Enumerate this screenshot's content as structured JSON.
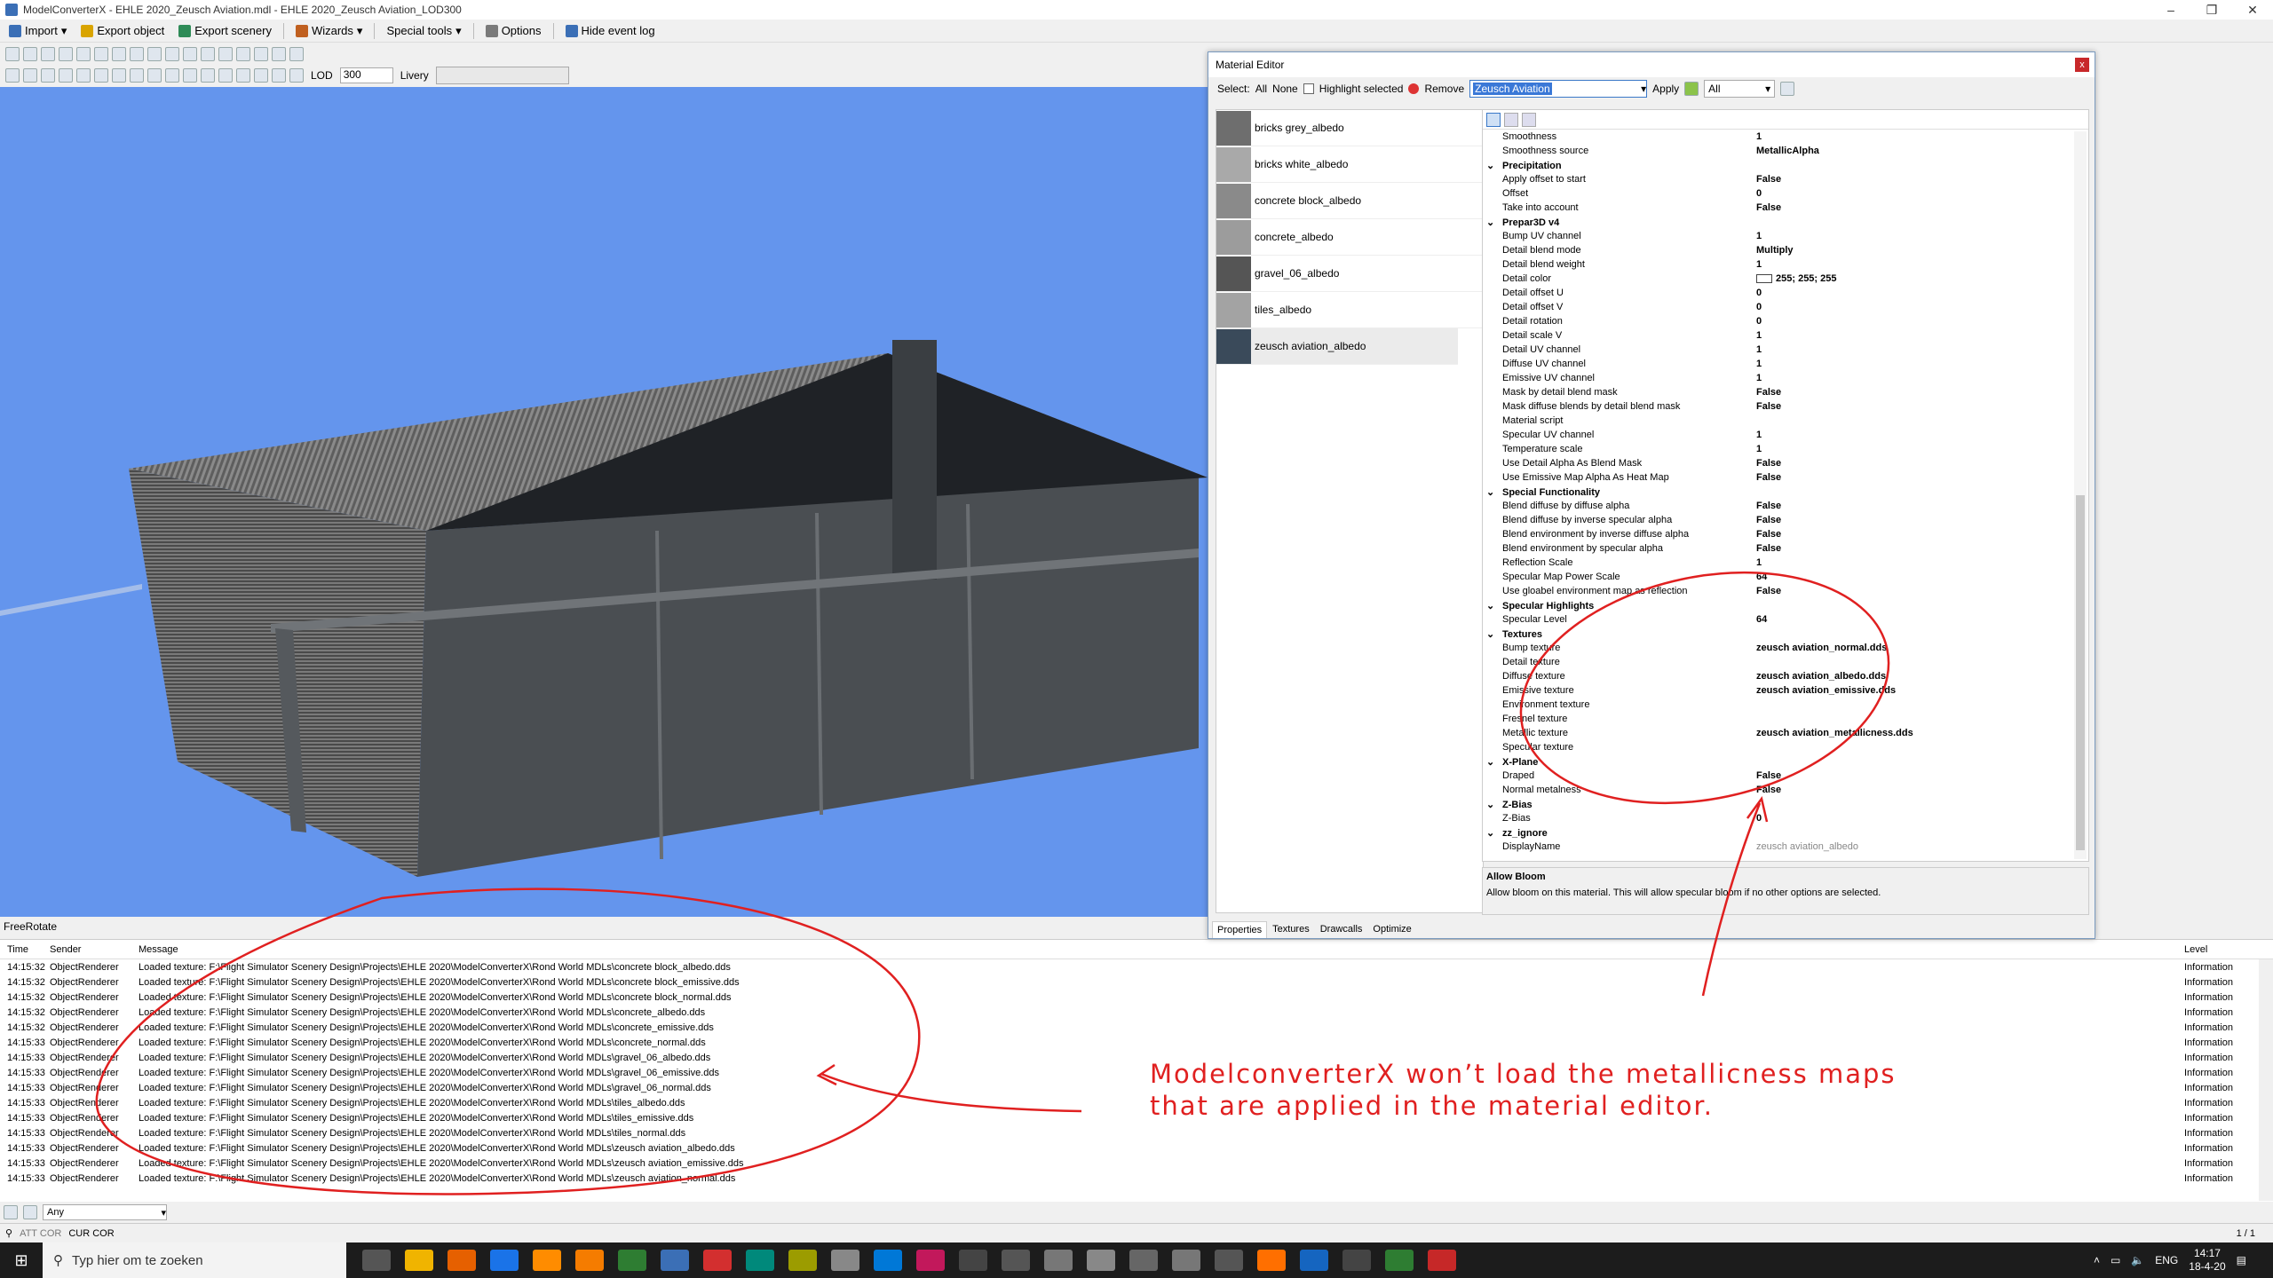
{
  "window": {
    "title": "ModelConverterX - EHLE 2020_Zeusch Aviation.mdl - EHLE 2020_Zeusch Aviation_LOD300",
    "controls": [
      "–",
      "❐",
      "✕"
    ]
  },
  "menubar": {
    "items": [
      {
        "label": "Import",
        "icon": "import-icon",
        "color": "#3b6fb6"
      },
      {
        "label": "Export object",
        "icon": "export-object-icon",
        "color": "#d9a400"
      },
      {
        "label": "Export scenery",
        "icon": "export-scenery-icon",
        "color": "#2e8b57"
      },
      {
        "label": "Wizards",
        "icon": "wizards-icon",
        "color": "#c06020"
      },
      {
        "label": "Special tools",
        "icon": "special-tools-icon",
        "color": "#777"
      },
      {
        "label": "Options",
        "icon": "options-icon",
        "color": "#7a7a7a"
      },
      {
        "label": "Hide event log",
        "icon": "event-log-icon",
        "color": "#3b6fb6"
      }
    ]
  },
  "toolbar2": {
    "lod_label": "LOD",
    "lod_value": "300",
    "livery_label": "Livery",
    "livery_value": ""
  },
  "viewport": {
    "mode_label": "FreeRotate",
    "background": "#6495ed"
  },
  "material_editor": {
    "title": "Material Editor",
    "close": "x",
    "toolbar": {
      "select_label": "Select:",
      "all_label": "All",
      "none_label": "None",
      "highlight_label": "Highlight selected",
      "remove_label": "Remove",
      "material_combo": "Zeusch Aviation",
      "apply_label": "Apply",
      "filter_combo": "All"
    },
    "materials": [
      {
        "name": "bricks grey_albedo",
        "swatch": "#6e6e6e"
      },
      {
        "name": "bricks white_albedo",
        "swatch": "#a9a9a9"
      },
      {
        "name": "concrete block_albedo",
        "swatch": "#8a8a8a"
      },
      {
        "name": "concrete_albedo",
        "swatch": "#9c9c9c"
      },
      {
        "name": "gravel_06_albedo",
        "swatch": "#555555"
      },
      {
        "name": "tiles_albedo",
        "swatch": "#a3a3a3"
      },
      {
        "name": "zeusch aviation_albedo",
        "swatch": "#3a4a5a"
      }
    ],
    "properties": [
      {
        "name": "Smoothness",
        "value": "1"
      },
      {
        "name": "Smoothness source",
        "value": "MetallicAlpha"
      },
      {
        "name": "Precipitation",
        "category": true
      },
      {
        "name": "Apply offset to start",
        "value": "False"
      },
      {
        "name": "Offset",
        "value": "0"
      },
      {
        "name": "Take into account",
        "value": "False"
      },
      {
        "name": "Prepar3D v4",
        "category": true
      },
      {
        "name": "Bump UV channel",
        "value": "1"
      },
      {
        "name": "Detail blend mode",
        "value": "Multiply"
      },
      {
        "name": "Detail blend weight",
        "value": "1"
      },
      {
        "name": "Detail color",
        "value": "255; 255; 255",
        "swatch": true
      },
      {
        "name": "Detail offset U",
        "value": "0"
      },
      {
        "name": "Detail offset V",
        "value": "0"
      },
      {
        "name": "Detail rotation",
        "value": "0"
      },
      {
        "name": "Detail scale V",
        "value": "1"
      },
      {
        "name": "Detail UV channel",
        "value": "1"
      },
      {
        "name": "Diffuse UV channel",
        "value": "1"
      },
      {
        "name": "Emissive UV channel",
        "value": "1"
      },
      {
        "name": "Mask by detail blend mask",
        "value": "False"
      },
      {
        "name": "Mask diffuse blends by detail blend mask",
        "value": "False"
      },
      {
        "name": "Material script",
        "value": ""
      },
      {
        "name": "Specular UV channel",
        "value": "1"
      },
      {
        "name": "Temperature scale",
        "value": "1"
      },
      {
        "name": "Use Detail Alpha As Blend Mask",
        "value": "False"
      },
      {
        "name": "Use Emissive Map Alpha As Heat Map",
        "value": "False"
      },
      {
        "name": "Special Functionality",
        "category": true
      },
      {
        "name": "Blend diffuse by diffuse alpha",
        "value": "False"
      },
      {
        "name": "Blend diffuse by inverse specular alpha",
        "value": "False"
      },
      {
        "name": "Blend environment by inverse diffuse alpha",
        "value": "False"
      },
      {
        "name": "Blend environment by specular alpha",
        "value": "False"
      },
      {
        "name": "Reflection Scale",
        "value": "1"
      },
      {
        "name": "Specular Map Power Scale",
        "value": "64"
      },
      {
        "name": "Use gloabel environment map as reflection",
        "value": "False"
      },
      {
        "name": "Specular Highlights",
        "category": true
      },
      {
        "name": "Specular Level",
        "value": "64"
      },
      {
        "name": "Textures",
        "category": true
      },
      {
        "name": "Bump texture",
        "value": "zeusch aviation_normal.dds"
      },
      {
        "name": "Detail texture",
        "value": ""
      },
      {
        "name": "Diffuse texture",
        "value": "zeusch aviation_albedo.dds"
      },
      {
        "name": "Emissive texture",
        "value": "zeusch aviation_emissive.dds"
      },
      {
        "name": "Environment texture",
        "value": ""
      },
      {
        "name": "Fresnel texture",
        "value": ""
      },
      {
        "name": "Metallic texture",
        "value": "zeusch aviation_metallicness.dds"
      },
      {
        "name": "Specular texture",
        "value": ""
      },
      {
        "name": "X-Plane",
        "category": true
      },
      {
        "name": "Draped",
        "value": "False"
      },
      {
        "name": "Normal metalness",
        "value": "False"
      },
      {
        "name": "Z-Bias",
        "category": true
      },
      {
        "name": "Z-Bias",
        "value": "0"
      },
      {
        "name": "zz_ignore",
        "category": true
      },
      {
        "name": "DisplayName",
        "value": "zeusch aviation_albedo",
        "gray": true
      }
    ],
    "description": {
      "title": "Allow Bloom",
      "text": "Allow bloom on this material. This will allow specular bloom if no other options are selected."
    },
    "tabs": [
      "Properties",
      "Textures",
      "Drawcalls",
      "Optimize"
    ],
    "active_tab": "Properties"
  },
  "log": {
    "columns": {
      "time": "Time",
      "sender": "Sender",
      "message": "Message",
      "level": "Level"
    },
    "rows": [
      {
        "time": "14:15:32",
        "sender": "ObjectRenderer",
        "message": "Loaded texture: F:\\Flight Simulator Scenery Design\\Projects\\EHLE 2020\\ModelConverterX\\Rond World MDLs\\concrete block_albedo.dds",
        "level": "Information"
      },
      {
        "time": "14:15:32",
        "sender": "ObjectRenderer",
        "message": "Loaded texture: F:\\Flight Simulator Scenery Design\\Projects\\EHLE 2020\\ModelConverterX\\Rond World MDLs\\concrete block_emissive.dds",
        "level": "Information"
      },
      {
        "time": "14:15:32",
        "sender": "ObjectRenderer",
        "message": "Loaded texture: F:\\Flight Simulator Scenery Design\\Projects\\EHLE 2020\\ModelConverterX\\Rond World MDLs\\concrete block_normal.dds",
        "level": "Information"
      },
      {
        "time": "14:15:32",
        "sender": "ObjectRenderer",
        "message": "Loaded texture: F:\\Flight Simulator Scenery Design\\Projects\\EHLE 2020\\ModelConverterX\\Rond World MDLs\\concrete_albedo.dds",
        "level": "Information"
      },
      {
        "time": "14:15:32",
        "sender": "ObjectRenderer",
        "message": "Loaded texture: F:\\Flight Simulator Scenery Design\\Projects\\EHLE 2020\\ModelConverterX\\Rond World MDLs\\concrete_emissive.dds",
        "level": "Information"
      },
      {
        "time": "14:15:33",
        "sender": "ObjectRenderer",
        "message": "Loaded texture: F:\\Flight Simulator Scenery Design\\Projects\\EHLE 2020\\ModelConverterX\\Rond World MDLs\\concrete_normal.dds",
        "level": "Information"
      },
      {
        "time": "14:15:33",
        "sender": "ObjectRenderer",
        "message": "Loaded texture: F:\\Flight Simulator Scenery Design\\Projects\\EHLE 2020\\ModelConverterX\\Rond World MDLs\\gravel_06_albedo.dds",
        "level": "Information"
      },
      {
        "time": "14:15:33",
        "sender": "ObjectRenderer",
        "message": "Loaded texture: F:\\Flight Simulator Scenery Design\\Projects\\EHLE 2020\\ModelConverterX\\Rond World MDLs\\gravel_06_emissive.dds",
        "level": "Information"
      },
      {
        "time": "14:15:33",
        "sender": "ObjectRenderer",
        "message": "Loaded texture: F:\\Flight Simulator Scenery Design\\Projects\\EHLE 2020\\ModelConverterX\\Rond World MDLs\\gravel_06_normal.dds",
        "level": "Information"
      },
      {
        "time": "14:15:33",
        "sender": "ObjectRenderer",
        "message": "Loaded texture: F:\\Flight Simulator Scenery Design\\Projects\\EHLE 2020\\ModelConverterX\\Rond World MDLs\\tiles_albedo.dds",
        "level": "Information"
      },
      {
        "time": "14:15:33",
        "sender": "ObjectRenderer",
        "message": "Loaded texture: F:\\Flight Simulator Scenery Design\\Projects\\EHLE 2020\\ModelConverterX\\Rond World MDLs\\tiles_emissive.dds",
        "level": "Information"
      },
      {
        "time": "14:15:33",
        "sender": "ObjectRenderer",
        "message": "Loaded texture: F:\\Flight Simulator Scenery Design\\Projects\\EHLE 2020\\ModelConverterX\\Rond World MDLs\\tiles_normal.dds",
        "level": "Information"
      },
      {
        "time": "14:15:33",
        "sender": "ObjectRenderer",
        "message": "Loaded texture: F:\\Flight Simulator Scenery Design\\Projects\\EHLE 2020\\ModelConverterX\\Rond World MDLs\\zeusch aviation_albedo.dds",
        "level": "Information"
      },
      {
        "time": "14:15:33",
        "sender": "ObjectRenderer",
        "message": "Loaded texture: F:\\Flight Simulator Scenery Design\\Projects\\EHLE 2020\\ModelConverterX\\Rond World MDLs\\zeusch aviation_emissive.dds",
        "level": "Information"
      },
      {
        "time": "14:15:33",
        "sender": "ObjectRenderer",
        "message": "Loaded texture: F:\\Flight Simulator Scenery Design\\Projects\\EHLE 2020\\ModelConverterX\\Rond World MDLs\\zeusch aviation_normal.dds",
        "level": "Information"
      }
    ],
    "filter_value": "Any"
  },
  "statusbar": {
    "att": "ATT COR",
    "cur": "CUR COR",
    "page": "1 / 1"
  },
  "annotation": {
    "line1": "ModelconverterX won’t load the metallicness maps",
    "line2": "that are applied in the material editor.",
    "color": "#e02020"
  },
  "taskbar": {
    "search_placeholder": "Typ hier om te zoeken",
    "lang": "ENG",
    "time": "14:17",
    "date": "18-4-20",
    "app_colors": [
      "#555",
      "#f0b400",
      "#e66000",
      "#1a73e8",
      "#ff8c00",
      "#f57c00",
      "#2e7d32",
      "#3b6fb6",
      "#d32f2f",
      "#00897b",
      "#9c9c00",
      "#888",
      "#0078d7",
      "#c2185b",
      "#444",
      "#555",
      "#777",
      "#888",
      "#666",
      "#777",
      "#555",
      "#ff6f00",
      "#1565c0",
      "#444",
      "#2e7d32",
      "#c62828"
    ]
  }
}
